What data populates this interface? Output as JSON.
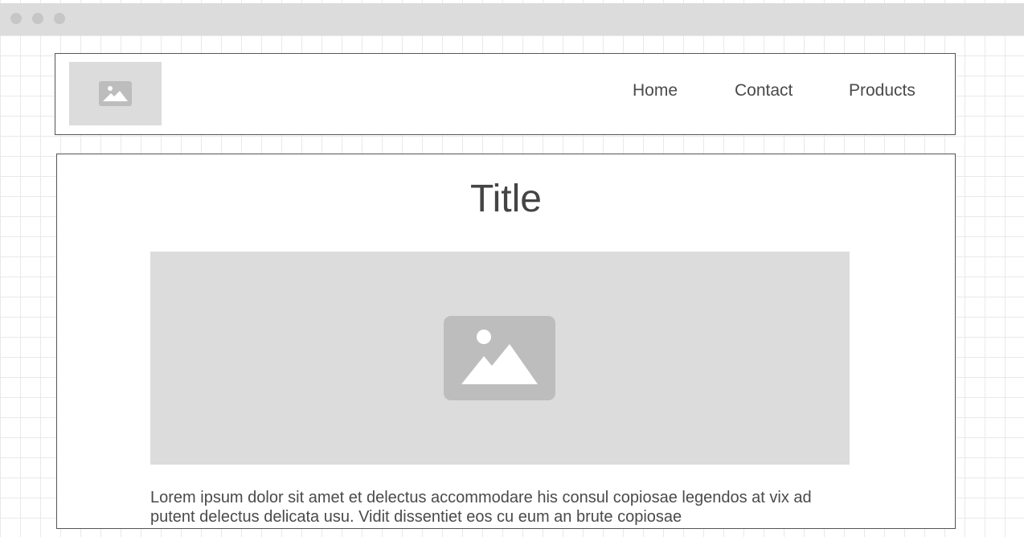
{
  "window": {
    "controls": [
      "window-dot",
      "window-dot",
      "window-dot"
    ]
  },
  "header": {
    "logo_icon": "image-icon",
    "nav": {
      "home": "Home",
      "contact": "Contact",
      "products": "Products"
    }
  },
  "main": {
    "title": "Title",
    "hero_icon": "image-icon",
    "body_text": "Lorem ipsum dolor sit amet et delectus accommodare his consul copiosae legendos at vix ad putent delectus delicata usu. Vidit dissentiet eos cu eum an brute copiosae"
  },
  "colors": {
    "titlebar": "#dcdcdc",
    "placeholder": "#dcdcdc",
    "placeholder_icon": "#bdbdbd",
    "border": "#555555",
    "text": "#4a4a4a",
    "grid": "#e9e9e9"
  }
}
